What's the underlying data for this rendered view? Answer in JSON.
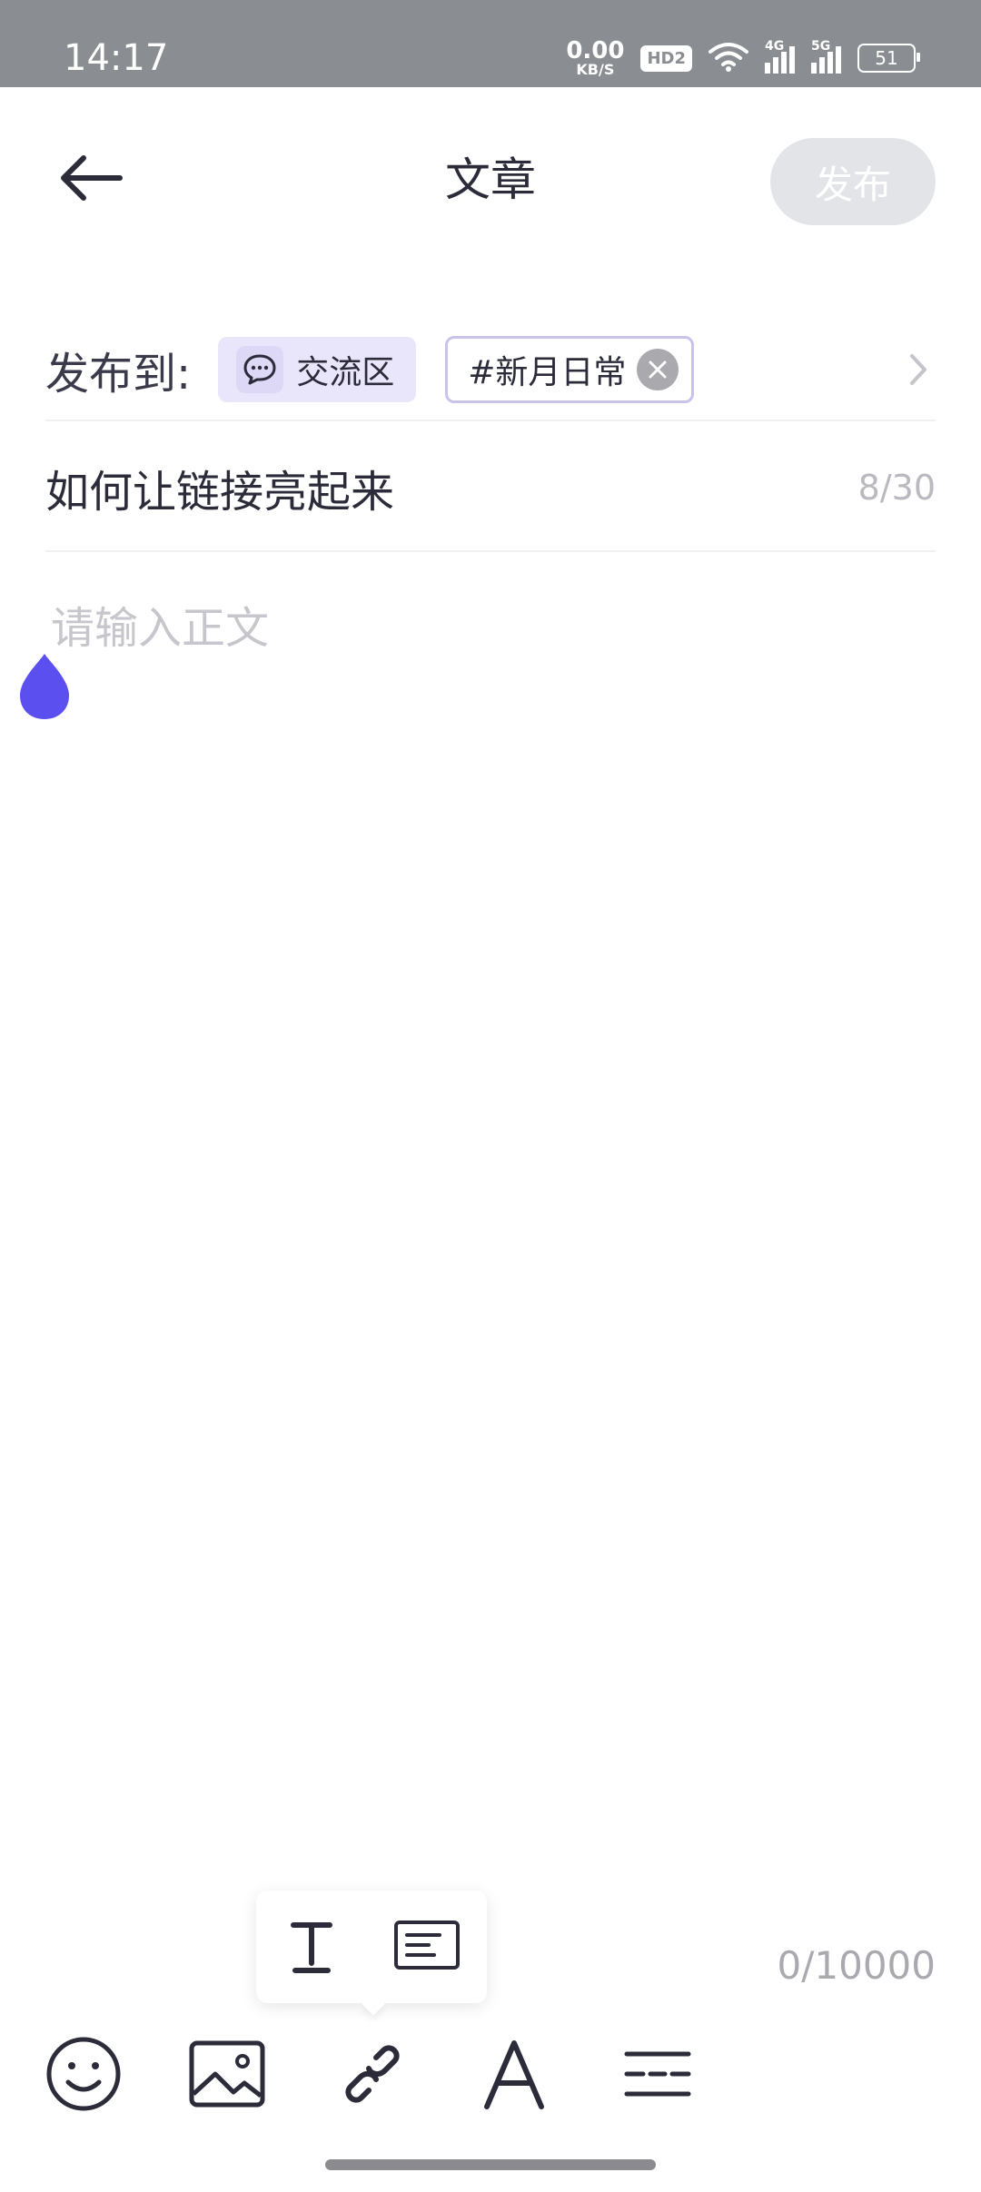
{
  "status_bar": {
    "time": "14:17",
    "net_speed_value": "0.00",
    "net_speed_unit": "KB/S",
    "hd_badge": "HD2",
    "signal_1_label": "4G",
    "signal_2_label": "5G",
    "battery": "51"
  },
  "header": {
    "title": "文章",
    "publish_label": "发布"
  },
  "publish_to": {
    "label": "发布到:",
    "community": "交流区",
    "topic": "#新月日常"
  },
  "article": {
    "title": "如何让链接亮起来",
    "title_count": "8/30",
    "body_placeholder": "请输入正文",
    "body_count": "0/10000"
  },
  "colors": {
    "accent": "#5b4ff0",
    "publish_disabled": "#e3e4e8",
    "chip_bg": "#e9e6fb"
  },
  "icons": {
    "back": "arrow-left-icon",
    "community": "chat-bubble-icon",
    "remove_topic": "close-icon",
    "expand": "chevron-right-icon",
    "text_style": "text-t-icon",
    "paragraph": "paragraph-card-icon",
    "emoji": "smiley-icon",
    "image": "image-icon",
    "link": "link-icon",
    "font": "font-a-icon",
    "divider": "divider-lines-icon"
  }
}
